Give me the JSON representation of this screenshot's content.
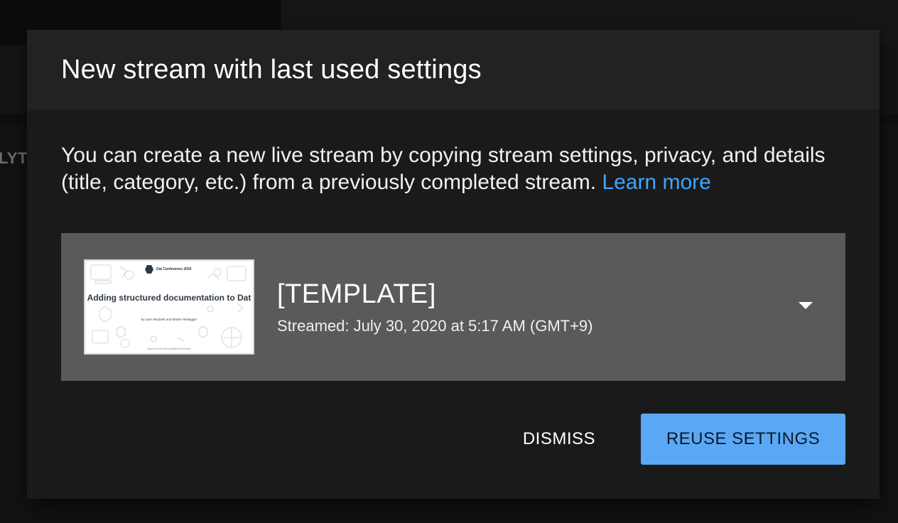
{
  "background": {
    "partial_label": "LYT"
  },
  "dialog": {
    "title": "New stream with last used settings",
    "description": "You can create a new live stream by copying stream settings, privacy, and details (title, category, etc.) from a previously completed stream.",
    "learn_more_label": "Learn more",
    "stream": {
      "title": "[TEMPLATE]",
      "streamed_text": "Streamed: July 30, 2020 at 5:17 AM (GMT+9)",
      "thumbnail": {
        "conference": "Dat Conference 2020",
        "title": "Adding structured documentation to Dat",
        "authors": "by Sam Macbeth and Martin Heidegger",
        "url": "https://events.dat.foundation/2020/talks"
      },
      "dropdown_icon": "caret-down-icon"
    },
    "actions": {
      "dismiss_label": "DISMISS",
      "reuse_label": "REUSE SETTINGS"
    }
  },
  "colors": {
    "accent": "#3ea6ff",
    "primary_button": "#5aa8f5",
    "dialog_bg": "#1a1a1a",
    "header_bg": "#222222",
    "card_bg": "#5a5a5a"
  }
}
